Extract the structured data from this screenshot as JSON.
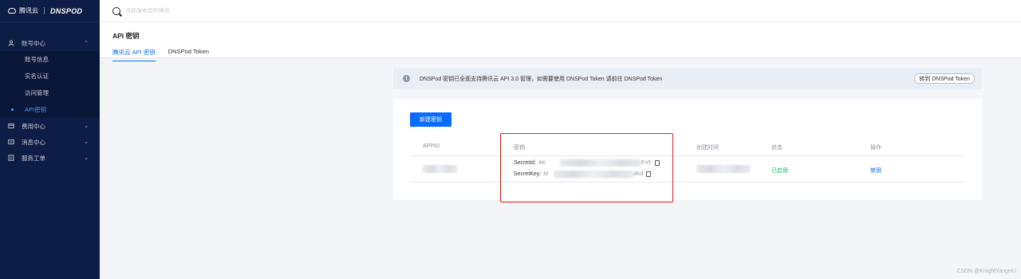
{
  "logo": {
    "tencent": "腾讯云",
    "brand": "DNSPOD"
  },
  "sidebar": {
    "account": "账号中心",
    "sub_items": [
      {
        "label": "账号信息"
      },
      {
        "label": "实名认证"
      },
      {
        "label": "访问管理"
      },
      {
        "label": "API密钥"
      }
    ],
    "groups": [
      {
        "label": "费用中心"
      },
      {
        "label": "消息中心"
      },
      {
        "label": "服务工单"
      }
    ]
  },
  "search": {
    "placeholder": "点此搜索您的域名"
  },
  "page": {
    "title": "API 密钥",
    "tabs": [
      {
        "label": "腾讯云 API 密钥"
      },
      {
        "label": "DNSPod Token"
      }
    ]
  },
  "notice": {
    "text": "DNSPod 密钥已全面支持腾讯云 API 3.0 管理，如需要使用 DNSPod Token 请前往 DNSPod Token",
    "button": "转到 DNSPod Token"
  },
  "card": {
    "create_button": "新建密钥",
    "columns": {
      "appid": "APPID",
      "key": "密钥",
      "created": "创建时间",
      "status": "状态",
      "ops": "操作"
    },
    "row": {
      "secret_id_label": "SecretId:",
      "secret_id_prefix": "AK",
      "secret_id_suffix": "Fn5",
      "secret_key_label": "SecretKey:",
      "secret_key_prefix": "M",
      "secret_key_suffix": "dKd",
      "status": "已启用",
      "action": "禁用"
    }
  },
  "watermark": "CSDN @KnightYangHU",
  "colors": {
    "sidebar_bg": "#0e1d46",
    "accent": "#0a6cff",
    "success": "#0abf5b",
    "highlight": "#e0211d"
  }
}
